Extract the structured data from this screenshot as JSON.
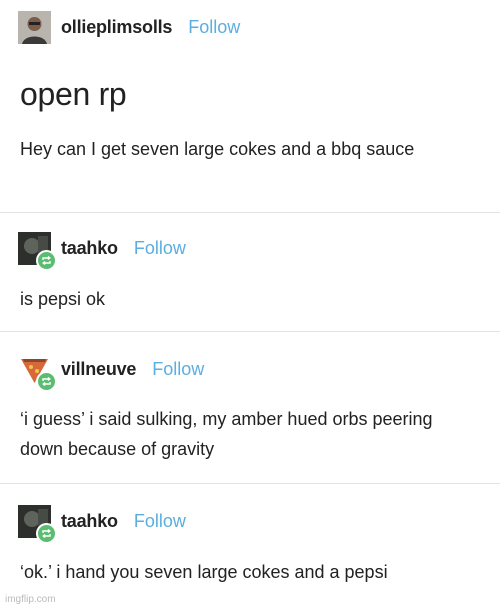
{
  "posts": [
    {
      "username": "ollieplimsolls",
      "follow_label": "Follow",
      "title": "open rp",
      "body": "Hey can I get seven large cokes and a bbq sauce"
    },
    {
      "username": "taahko",
      "follow_label": "Follow",
      "body": "is pepsi ok"
    },
    {
      "username": "villneuve",
      "follow_label": "Follow",
      "body": "‘i guess’ i said sulking, my amber hued orbs peering down because of gravity"
    },
    {
      "username": "taahko",
      "follow_label": "Follow",
      "body": "‘ok.’ i hand you seven large cokes and a pepsi"
    }
  ],
  "watermark": "imgflip.com",
  "colors": {
    "follow": "#5aaee0",
    "reblog_badge": "#5bbd72",
    "separator": "#e3e3e3"
  },
  "icons": [
    "avatar-photo",
    "reblog-icon"
  ]
}
